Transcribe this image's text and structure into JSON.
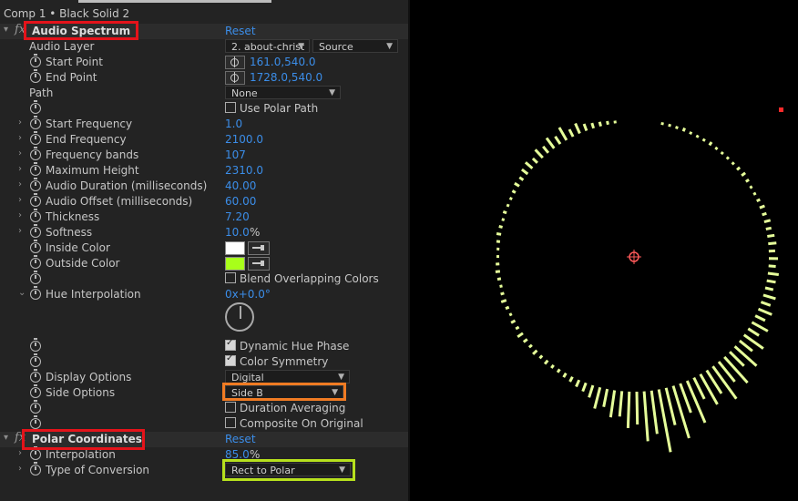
{
  "comp_title": "Comp 1 • Black Solid 2",
  "effects": {
    "audio_spectrum": {
      "name": "Audio Spectrum",
      "reset": "Reset",
      "audio_layer": {
        "label": "Audio Layer",
        "value": "2. about-christ",
        "source": "Source"
      },
      "start_point": {
        "label": "Start Point",
        "value": "161.0,540.0"
      },
      "end_point": {
        "label": "End Point",
        "value": "1728.0,540.0"
      },
      "path": {
        "label": "Path",
        "value": "None"
      },
      "use_polar_path": "Use Polar Path",
      "start_frequency": {
        "label": "Start Frequency",
        "value": "1.0"
      },
      "end_frequency": {
        "label": "End Frequency",
        "value": "2100.0"
      },
      "frequency_bands": {
        "label": "Frequency bands",
        "value": "107"
      },
      "maximum_height": {
        "label": "Maximum Height",
        "value": "2310.0"
      },
      "audio_duration": {
        "label": "Audio Duration (milliseconds)",
        "value": "40.00"
      },
      "audio_offset": {
        "label": "Audio Offset (milliseconds)",
        "value": "60.00"
      },
      "thickness": {
        "label": "Thickness",
        "value": "7.20"
      },
      "softness": {
        "label": "Softness",
        "value": "10.0",
        "unit": "%"
      },
      "inside_color": {
        "label": "Inside Color",
        "color": "#ffffff"
      },
      "outside_color": {
        "label": "Outside Color",
        "color": "#a8ff1a"
      },
      "blend_overlapping": "Blend Overlapping Colors",
      "hue_interpolation": {
        "label": "Hue Interpolation",
        "value": "0x+0.0°"
      },
      "dynamic_hue_phase": "Dynamic Hue Phase",
      "color_symmetry": "Color Symmetry",
      "display_options": {
        "label": "Display Options",
        "value": "Digital"
      },
      "side_options": {
        "label": "Side Options",
        "value": "Side B"
      },
      "duration_averaging": "Duration Averaging",
      "composite_on_original": "Composite On Original"
    },
    "polar_coordinates": {
      "name": "Polar Coordinates",
      "reset": "Reset",
      "interpolation": {
        "label": "Interpolation",
        "value": "85.0",
        "unit": "%"
      },
      "type_of_conversion": {
        "label": "Type of Conversion",
        "value": "Rect to Polar"
      }
    }
  },
  "checkbox_states": {
    "use_polar_path": false,
    "blend_overlapping": false,
    "dynamic_hue_phase": true,
    "color_symmetry": true,
    "duration_averaging": false,
    "composite_on_original": false
  },
  "colors": {
    "accent_blue": "#3b8de8",
    "annotation_red": "#e4131a",
    "annotation_orange": "#f07b23",
    "annotation_green": "#b6e01d",
    "spectrum_color": "#e6ff9a"
  }
}
